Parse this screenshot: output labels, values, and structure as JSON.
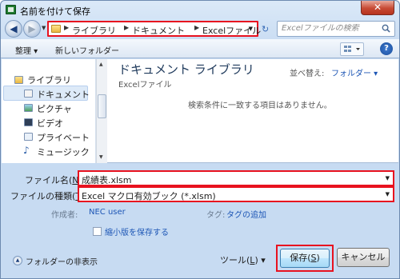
{
  "window": {
    "title": "名前を付けて保存",
    "close_glyph": "✕"
  },
  "nav": {
    "address_crumbs": [
      "ライブラリ",
      "ドキュメント",
      "Excelファイル"
    ],
    "search_placeholder": "Excelファイルの検索"
  },
  "toolbar": {
    "organize": "整理 ▾",
    "new_folder": "新しいフォルダー"
  },
  "sidebar": {
    "items": [
      {
        "label": "ライブラリ",
        "icon": "library-icon"
      },
      {
        "label": "ドキュメント",
        "icon": "documents-icon",
        "selected": true
      },
      {
        "label": "ピクチャ",
        "icon": "pictures-icon"
      },
      {
        "label": "ビデオ",
        "icon": "video-icon"
      },
      {
        "label": "プライベート",
        "icon": "private-icon"
      },
      {
        "label": "ミュージック",
        "icon": "music-icon"
      }
    ]
  },
  "content": {
    "library_title": "ドキュメント ライブラリ",
    "library_subtitle": "Excelファイル",
    "sort_label": "並べ替え:",
    "sort_value": "フォルダー ▾",
    "empty_message": "検索条件に一致する項目はありません。"
  },
  "form": {
    "filename_label": "ファイル名(",
    "filename_key": "N",
    "filename_suffix": "):",
    "filename_value": "成績表.xlsm",
    "filetype_label": "ファイルの種類(",
    "filetype_key": "T",
    "filetype_suffix": "):",
    "filetype_value": "Excel マクロ有効ブック (*.xlsm)",
    "author_label": "作成者:",
    "author_value": "NEC user",
    "tag_label": "タグ:",
    "tag_value": "タグの追加",
    "thumbnail_label": "縮小版を保存する"
  },
  "footer": {
    "hide_folders": "フォルダーの非表示",
    "tools": "ツール(",
    "tools_key": "L",
    "tools_suffix": ") ▾",
    "save": "保存(",
    "save_key": "S",
    "save_suffix": ")",
    "cancel": "キャンセル"
  },
  "colors": {
    "highlight": "#e8121f",
    "link": "#1d56b5",
    "library_title": "#1e395b"
  }
}
